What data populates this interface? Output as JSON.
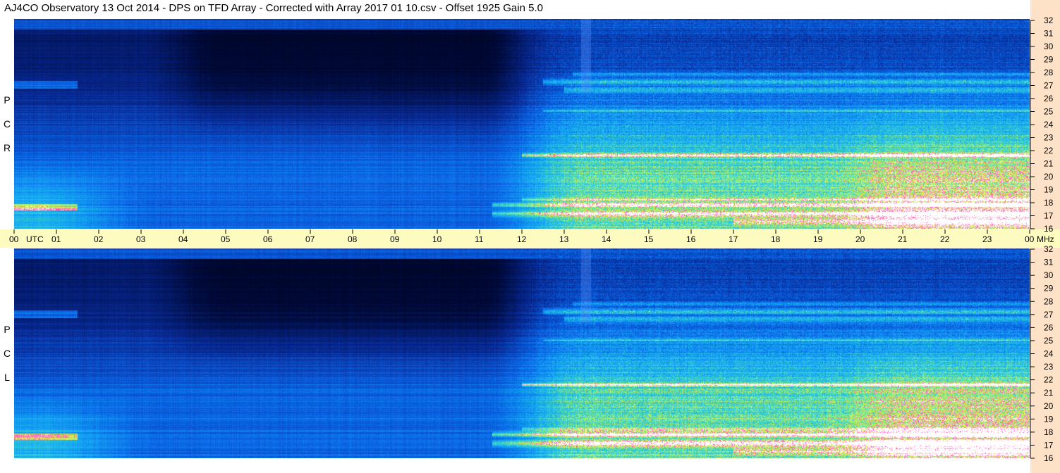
{
  "title": "AJ4CO Observatory  13 Oct 2014  -  DPS on TFD Array  -  Corrected with Array 2017 01 10.csv  -  Offset 1925  Gain 5.0",
  "chart_data": {
    "type": "heatmap",
    "panels": [
      {
        "name": "RCP",
        "label_letters": [
          "P",
          "C",
          "R"
        ]
      },
      {
        "name": "LCP",
        "label_letters": [
          "P",
          "C",
          "L"
        ]
      }
    ],
    "x_axis": {
      "unit_label": "UTC",
      "tick_labels": [
        "00",
        "01",
        "02",
        "03",
        "04",
        "05",
        "06",
        "07",
        "08",
        "09",
        "10",
        "11",
        "12",
        "13",
        "14",
        "15",
        "16",
        "17",
        "18",
        "19",
        "20",
        "21",
        "22",
        "23",
        "00"
      ],
      "range": [
        0,
        24
      ]
    },
    "y_axis": {
      "unit_label": "MHz",
      "tick_labels": [
        "16",
        "17",
        "18",
        "19",
        "20",
        "21",
        "22",
        "23",
        "24",
        "25",
        "26",
        "27",
        "28",
        "29",
        "30",
        "31",
        "32"
      ],
      "range": [
        16,
        32
      ]
    },
    "colors": {
      "low": "#000a3a",
      "mid": "#0a64e6",
      "high": "#9ef27a",
      "peak": "#ff40c0",
      "saturated": "#ffffff",
      "time_band": "#fdfbc0",
      "right_strip": "#fde2c8"
    }
  }
}
